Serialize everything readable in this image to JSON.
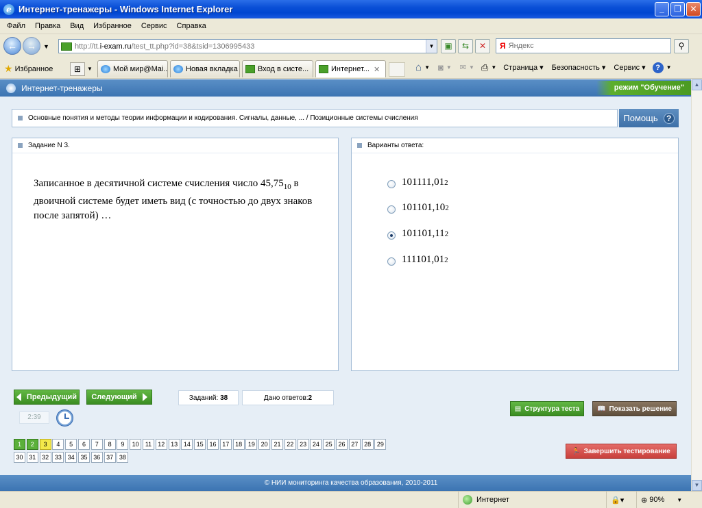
{
  "window": {
    "title": "Интернет-тренажеры - Windows Internet Explorer"
  },
  "menu": [
    "Файл",
    "Правка",
    "Вид",
    "Избранное",
    "Сервис",
    "Справка"
  ],
  "address": {
    "url_prefix": "http://tt.",
    "url_domain": "i-exam.ru",
    "url_rest": "/test_tt.php?id=38&tsid=1306995433",
    "search_placeholder": "Яндекс",
    "search_brand": "Я"
  },
  "favorites": {
    "label": "Избранное"
  },
  "tabs": [
    {
      "label": "Мой мир@Mai...",
      "icon": "ie"
    },
    {
      "label": "Новая вкладка",
      "icon": "ie"
    },
    {
      "label": "Вход в систе...",
      "icon": "green"
    },
    {
      "label": "Интернет...",
      "icon": "green",
      "active": true
    }
  ],
  "commandbar": {
    "page": "Страница",
    "safety": "Безопасность",
    "service": "Сервис"
  },
  "app": {
    "name": "Интернет-тренажеры",
    "mode": "режим \"Обучение\"",
    "breadcrumb": "Основные понятия и методы теории информации и кодирования. Сигналы, данные, ... / Позиционные системы счисления",
    "help": "Помощь",
    "help_symbol": "?"
  },
  "question": {
    "header": "Задание N 3.",
    "text_before": "Записанное в десятичной системе счисления число 45,75",
    "base": "10",
    "text_after": "в двоичной системе будет иметь вид (с точностью до двух знаков после запятой) …"
  },
  "answers": {
    "header": "Варианты ответа:",
    "options": [
      {
        "value": "101111,01",
        "base": "2",
        "selected": false
      },
      {
        "value": "101101,10",
        "base": "2",
        "selected": false
      },
      {
        "value": "101101,11",
        "base": "2",
        "selected": true
      },
      {
        "value": "111101,01",
        "base": "2",
        "selected": false
      }
    ]
  },
  "controls": {
    "prev": "Предыдущий",
    "next": "Следующий",
    "tasks_label": "Заданий:",
    "tasks_count": "38",
    "answered_label": "Дано ответов:",
    "answered_count": "2",
    "timer": "2:39",
    "structure": "Структура теста",
    "show_solution": "Показать решение",
    "finish": "Завершить тестирование"
  },
  "task_numbers": {
    "count": 38,
    "answered": [
      1,
      2
    ],
    "current": 3
  },
  "footer": "© НИИ мониторинга качества образования, 2010-2011",
  "status": {
    "zone": "Интернет",
    "zoom": "90%"
  },
  "colors": {
    "header_blue": "#3c74b2",
    "green": "#4b9a22",
    "red": "#d9534f",
    "brown": "#6b5a45"
  }
}
